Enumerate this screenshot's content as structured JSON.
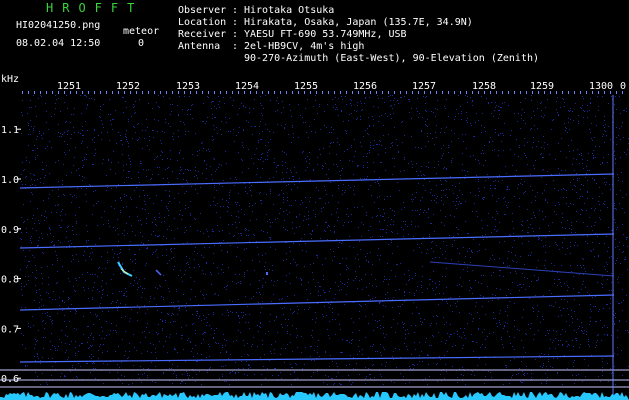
{
  "header": {
    "brand": "HROFFT",
    "filename": "HI02041250.png",
    "datetime": "08.02.04 12:50",
    "meteor_label": "meteor",
    "meteor_count": "0",
    "info": [
      {
        "key": "Observer",
        "sep": ":",
        "value": "Hirotaka Otsuka"
      },
      {
        "key": "Location",
        "sep": ":",
        "value": "Hirakata, Osaka, Japan (135.7E, 34.9N)"
      },
      {
        "key": "Receiver",
        "sep": ":",
        "value": "YAESU FT-690 53.749MHz, USB"
      },
      {
        "key": "Antenna",
        "sep": ":",
        "value": "2el-HB9CV, 4m's high"
      },
      {
        "key": "",
        "sep": "",
        "value": "90-270-Azimuth (East-West), 90-Elevation (Zenith)"
      }
    ]
  },
  "spectrogram": {
    "unit_label": "kHz",
    "y_ticks": [
      "1.1",
      "1.0",
      "0.9",
      "0.8",
      "0.7",
      "0.6"
    ],
    "y_values": [
      1.1,
      1.0,
      0.9,
      0.8,
      0.7,
      0.6
    ],
    "x_ticks": [
      "1251",
      "1252",
      "1253",
      "1254",
      "1255",
      "1256",
      "1257",
      "1258",
      "1259",
      "1300",
      "0"
    ],
    "colors": {
      "background": "#000000",
      "noise": "#1a2a9a",
      "tone": "#4a6cff",
      "reference": "#c8c8ff",
      "echo": "#3fd0ff",
      "baseline": "#27c8ff",
      "text": "#ffffff",
      "brand": "#3cd33c"
    }
  }
}
